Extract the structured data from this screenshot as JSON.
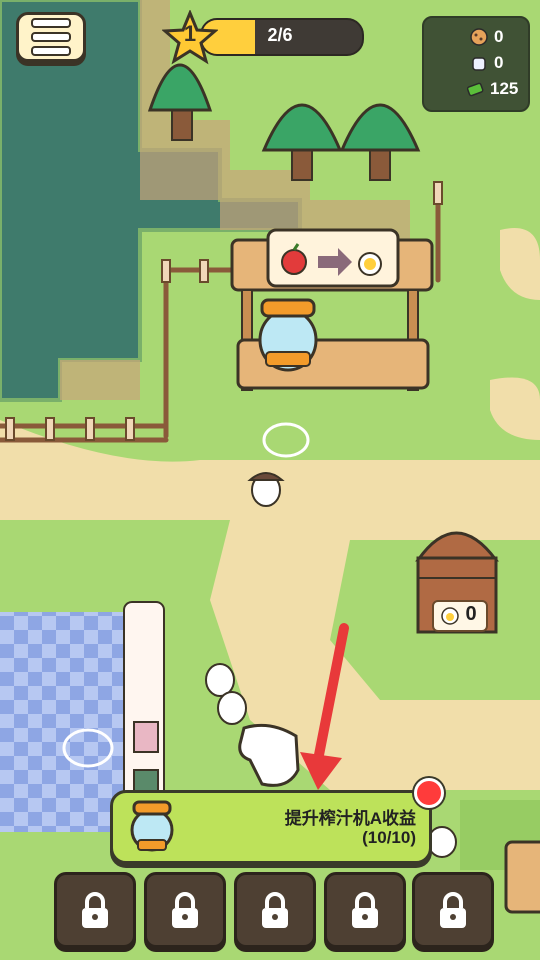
{
  "hud": {
    "level": "1",
    "xp_text": "2/6",
    "xp_progress": 0.33,
    "resources": [
      {
        "icon": "cookie-icon",
        "value": "0"
      },
      {
        "icon": "milk-icon",
        "value": "0"
      },
      {
        "icon": "cash-icon",
        "value": "125"
      }
    ]
  },
  "stand": {
    "recipe_input_icon": "apple-icon",
    "recipe_output_icon": "juice-bottle-icon"
  },
  "barn": {
    "item_icon": "juice-bottle-icon",
    "count": "0"
  },
  "task": {
    "title": "提升榨汁机A收益",
    "progress": "(10/10)",
    "icon": "juicer-icon"
  },
  "bottom_slots": [
    {
      "icon": "lock-icon",
      "locked": true
    },
    {
      "icon": "lock-icon",
      "locked": true
    },
    {
      "icon": "lock-icon",
      "locked": true
    },
    {
      "icon": "lock-icon",
      "locked": true
    },
    {
      "icon": "lock-icon",
      "locked": true
    }
  ],
  "colors": {
    "grass": "#a9d873",
    "path": "#f1deaa",
    "water": "#3f7b6c",
    "task_bg": "#bde25a",
    "xp_fill": "#ffcf3d",
    "arrow": "#e8393a"
  }
}
